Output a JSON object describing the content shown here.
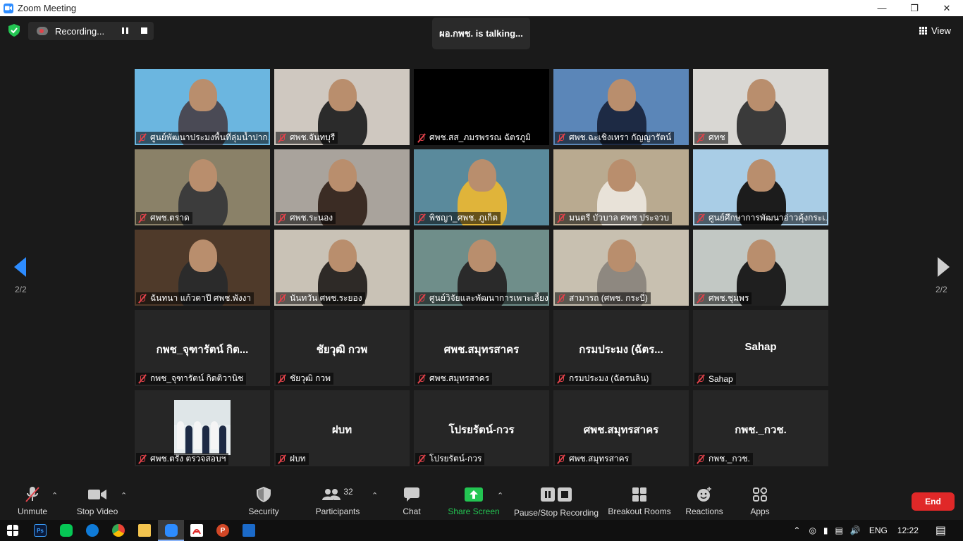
{
  "window": {
    "title": "Zoom Meeting"
  },
  "top": {
    "recording_label": "Recording...",
    "talking": "ผอ.กพช. is  talking...",
    "view_label": "View"
  },
  "pager": {
    "left": "2/2",
    "right": "2/2"
  },
  "tiles": [
    {
      "name": "ศูนย์พัฒนาประมงพื้นที่ลุ่มน้ำปาก...",
      "bg": "#6bb6e0",
      "person": "#4a4a55",
      "center": ""
    },
    {
      "name": "ศพช.จันทบุรี",
      "bg": "#cfc8c0",
      "person": "#2b2b2b",
      "center": ""
    },
    {
      "name": "ศพช.สส_ภมรพรรณ  ฉัตรภูมิ",
      "bg": "#000000",
      "person": "",
      "center": ""
    },
    {
      "name": "ศพช.ฉะเชิงเทรา กัญญารัตน์",
      "bg": "#5b86b8",
      "person": "#1d2a44",
      "center": ""
    },
    {
      "name": "ศทช",
      "bg": "#d9d7d3",
      "person": "#3a3a3a",
      "center": ""
    },
    {
      "name": "ศพช.ตราด",
      "bg": "#8a8168",
      "person": "#3c3c3c",
      "center": ""
    },
    {
      "name": "ศพช.ระนอง",
      "bg": "#a9a39c",
      "person": "#3b2c24",
      "center": ""
    },
    {
      "name": "พิชญา_ศพช. ภูเก็ต",
      "bg": "#5a8a9c",
      "person": "#e0b43a",
      "center": ""
    },
    {
      "name": "มนตรี บัวบาล ศพช ประจวบ",
      "bg": "#b9aa90",
      "person": "#e8e2d8",
      "center": ""
    },
    {
      "name": "ศูนย์ศึกษาการพัฒนาอ่าวคุ้งกระเ...",
      "bg": "#a9cde6",
      "person": "#1c1c1c",
      "center": ""
    },
    {
      "name": "ฉันทนา  แก้วตาปี ศพช.พังงา",
      "bg": "#4f3a2a",
      "person": "#2b2b2b",
      "center": ""
    },
    {
      "name": "นันทวัน ศพช.ระยอง",
      "bg": "#c9c2b6",
      "person": "#2e2a27",
      "center": ""
    },
    {
      "name": "ศูนย์วิจัยและพัฒนาการเพาะเลี้ยง...",
      "bg": "#6f8e8a",
      "person": "#2a2a2a",
      "center": ""
    },
    {
      "name": "สามารถ (ศพช. กระบี่)",
      "bg": "#c8c0b0",
      "person": "#8e8880",
      "center": ""
    },
    {
      "name": "ศพช.ชุมพร",
      "bg": "#c2c8c4",
      "person": "#1f1f1f",
      "center": ""
    },
    {
      "name": "กพช_จุฑารัตน์ กิตติวานิช",
      "bg": "#262626",
      "person": "",
      "center": "กพช_จุฑารัตน์ กิต..."
    },
    {
      "name": "ชัยวุฒิ กวพ",
      "bg": "#262626",
      "person": "",
      "center": "ชัยวุฒิ กวพ"
    },
    {
      "name": "ศพช.สมุทรสาคร",
      "bg": "#262626",
      "person": "",
      "center": "ศพช.สมุทรสาคร"
    },
    {
      "name": "กรมประมง (ฉัตรนลิน)",
      "bg": "#262626",
      "person": "",
      "center": "กรมประมง (ฉัตร..."
    },
    {
      "name": "Sahap",
      "bg": "#262626",
      "person": "",
      "center": "Sahap"
    },
    {
      "name": "ศพช.ตรัง ตรวจสอบฯ",
      "bg": "#262626",
      "person": "",
      "center": "",
      "photo": true
    },
    {
      "name": "ฝบท",
      "bg": "#262626",
      "person": "",
      "center": "ฝบท"
    },
    {
      "name": "โปรยรัตน์-กวร",
      "bg": "#262626",
      "person": "",
      "center": "โปรยรัตน์-กวร"
    },
    {
      "name": "ศพช.สมุทรสาคร",
      "bg": "#262626",
      "person": "",
      "center": "ศพช.สมุทรสาคร"
    },
    {
      "name": "กพช._กวช.",
      "bg": "#262626",
      "person": "",
      "center": "กพช._กวช."
    }
  ],
  "toolbar": {
    "unmute": "Unmute",
    "stop_video": "Stop Video",
    "security": "Security",
    "participants": "Participants",
    "participants_count": "32",
    "chat": "Chat",
    "share_screen": "Share Screen",
    "pause_stop_recording": "Pause/Stop Recording",
    "breakout_rooms": "Breakout Rooms",
    "reactions": "Reactions",
    "apps": "Apps",
    "end": "End"
  },
  "taskbar": {
    "lang": "ENG",
    "time": "12:22"
  }
}
